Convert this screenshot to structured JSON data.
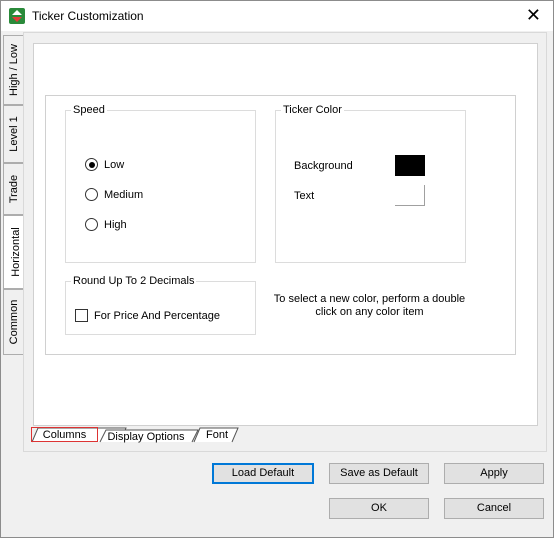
{
  "window": {
    "title": "Ticker Customization",
    "close_glyph": "✕"
  },
  "side_tabs": [
    "High / Low",
    "Level 1",
    "Trade",
    "Horizontal",
    "Common"
  ],
  "speed": {
    "legend": "Speed",
    "options": [
      "Low",
      "Medium",
      "High"
    ],
    "selected": "Low"
  },
  "ticker_color": {
    "legend": "Ticker Color",
    "background_label": "Background",
    "background_color": "#000000",
    "text_label": "Text",
    "text_color": "#ffffff"
  },
  "round_up": {
    "legend": "Round Up To 2 Decimals",
    "checkbox_label": "For Price And Percentage",
    "checked": false
  },
  "note": "To select a new color, perform a double click on any color item",
  "bottom_tabs": [
    "Columns",
    "Display Options",
    "Font"
  ],
  "buttons": {
    "load_default": "Load Default",
    "save_default": "Save as Default",
    "apply": "Apply",
    "ok": "OK",
    "cancel": "Cancel"
  }
}
